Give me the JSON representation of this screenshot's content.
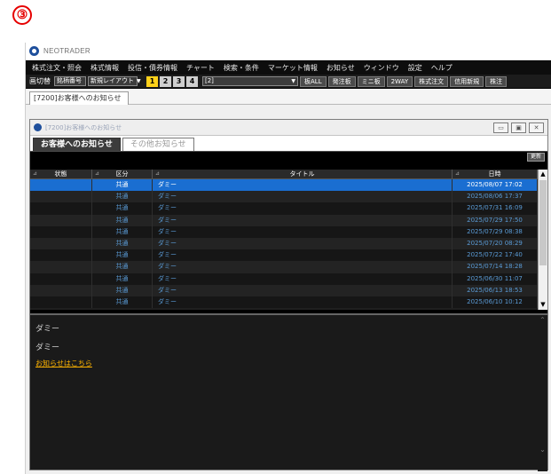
{
  "step_marker": "③",
  "app": {
    "title": "NEOTRADER",
    "menu": [
      "株式注文・照会",
      "株式情報",
      "投信・債券情報",
      "チャート",
      "検索・条件",
      "マーケット情報",
      "お知らせ",
      "ウィンドウ",
      "設定",
      "ヘルプ"
    ],
    "toolbar": {
      "switch_label": "画切替",
      "code_input_value": "銘柄番号",
      "layout_dropdown": "新規レイアウト",
      "screens": [
        "1",
        "2",
        "3",
        "4"
      ],
      "active_screen": "1",
      "combo_value": "[2]",
      "buttons": [
        "板ALL",
        "発注板",
        "ミニ板",
        "2WAY",
        "株式注文",
        "信用新規",
        "株注"
      ]
    },
    "doc_tab": "[7200]お客様へのお知らせ"
  },
  "inner_window": {
    "title": "[7200]お客様へのお知らせ",
    "controls": [
      "▭",
      "▣",
      "✕"
    ],
    "tabs": [
      {
        "label": "お客様へのお知らせ",
        "active": true
      },
      {
        "label": "その他お知らせ",
        "active": false
      }
    ],
    "update_button": "更新",
    "grid": {
      "headers": [
        "状態",
        "区分",
        "タイトル",
        "日時"
      ],
      "rows": [
        {
          "status": "",
          "category": "共通",
          "title": "ダミー",
          "date": "2025/08/07 17:02"
        },
        {
          "status": "",
          "category": "共通",
          "title": "ダミー",
          "date": "2025/08/06 17:37"
        },
        {
          "status": "",
          "category": "共通",
          "title": "ダミー",
          "date": "2025/07/31 16:09"
        },
        {
          "status": "",
          "category": "共通",
          "title": "ダミー",
          "date": "2025/07/29 17:50"
        },
        {
          "status": "",
          "category": "共通",
          "title": "ダミー",
          "date": "2025/07/29 08:38"
        },
        {
          "status": "",
          "category": "共通",
          "title": "ダミー",
          "date": "2025/07/20 08:29"
        },
        {
          "status": "",
          "category": "共通",
          "title": "ダミー",
          "date": "2025/07/22 17:40"
        },
        {
          "status": "",
          "category": "共通",
          "title": "ダミー",
          "date": "2025/07/14 18:28"
        },
        {
          "status": "",
          "category": "共通",
          "title": "ダミー",
          "date": "2025/06/30 11:07"
        },
        {
          "status": "",
          "category": "共通",
          "title": "ダミー",
          "date": "2025/06/13 18:53"
        },
        {
          "status": "",
          "category": "共通",
          "title": "ダミー",
          "date": "2025/06/10 10:12"
        }
      ]
    },
    "detail": {
      "title": "ダミー",
      "body": "ダミー",
      "link": "お知らせはこちら"
    }
  }
}
